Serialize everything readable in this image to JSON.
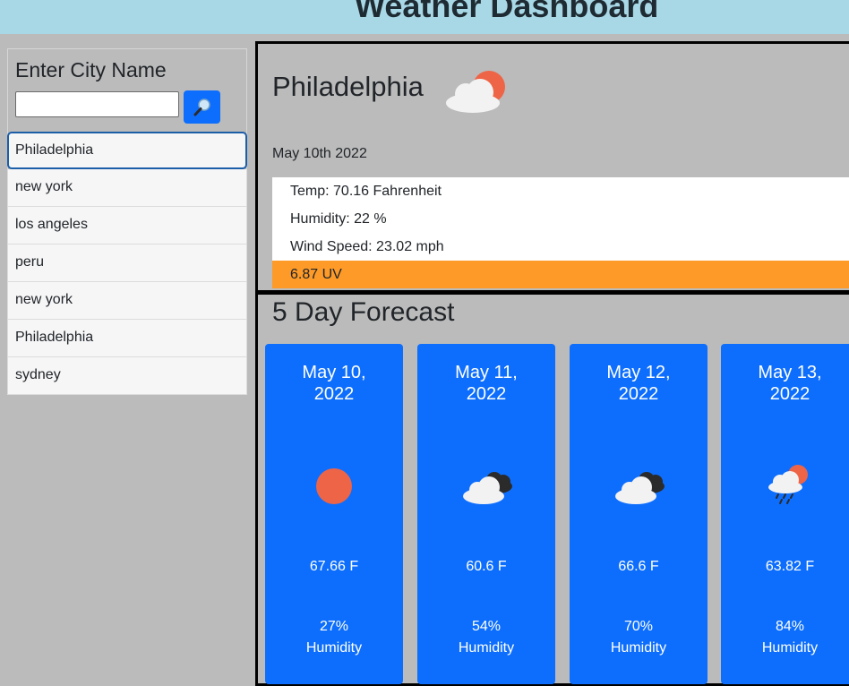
{
  "header": {
    "title": "Weather Dashboard"
  },
  "sidebar": {
    "label": "Enter City Name",
    "search_value": "",
    "search_placeholder": "",
    "history": [
      "Philadelphia",
      "new york",
      "los angeles",
      "peru",
      "new york",
      "Philadelphia",
      "sydney"
    ]
  },
  "current": {
    "city": "Philadelphia",
    "icon": "sun-behind-cloud-icon",
    "date": "May 10th 2022",
    "temp": "Temp: 70.16 Fahrenheit",
    "humidity": "Humidity: 22 %",
    "wind": "Wind Speed: 23.02 mph",
    "uv": "6.87 UV",
    "uv_color": "#fd9a28"
  },
  "forecast": {
    "title": "5 Day Forecast",
    "cards": [
      {
        "date_line1": "May 10,",
        "date_line2": "2022",
        "icon": "sun-icon",
        "temp": "67.66 F",
        "humidity_value": "27%",
        "humidity_label": "Humidity"
      },
      {
        "date_line1": "May 11,",
        "date_line2": "2022",
        "icon": "dark-clouds-icon",
        "temp": "60.6 F",
        "humidity_value": "54%",
        "humidity_label": "Humidity"
      },
      {
        "date_line1": "May 12,",
        "date_line2": "2022",
        "icon": "dark-clouds-icon",
        "temp": "66.6 F",
        "humidity_value": "70%",
        "humidity_label": "Humidity"
      },
      {
        "date_line1": "May 13,",
        "date_line2": "2022",
        "icon": "rain-sun-cloud-icon",
        "temp": "63.82 F",
        "humidity_value": "84%",
        "humidity_label": "Humidity"
      }
    ]
  },
  "colors": {
    "header_bg": "#a8d8e6",
    "card_bg": "#0d6efd",
    "page_bg": "#bbbbbb",
    "uv": "#fd9a28"
  }
}
